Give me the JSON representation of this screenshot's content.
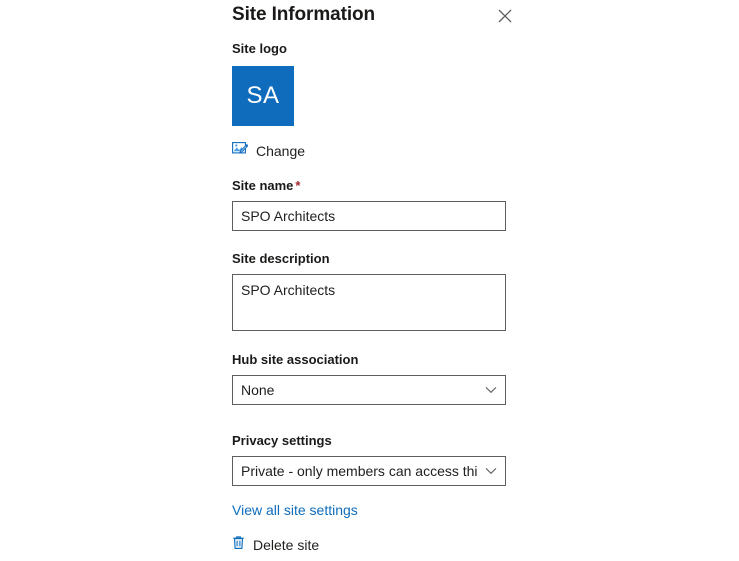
{
  "panel": {
    "title": "Site Information",
    "close_icon": "close-icon"
  },
  "logo": {
    "label": "Site logo",
    "initials": "SA",
    "background_color": "#0f6cbd",
    "change_label": "Change",
    "change_icon": "image-edit-icon"
  },
  "site_name": {
    "label": "Site name",
    "required_marker": "*",
    "value": "SPO Architects",
    "placeholder": ""
  },
  "site_description": {
    "label": "Site description",
    "value": "SPO Architects",
    "placeholder": ""
  },
  "hub_site": {
    "label": "Hub site association",
    "value": "None",
    "caret_icon": "chevron-down-icon"
  },
  "privacy": {
    "label": "Privacy settings",
    "value": "Private - only members can access this ...",
    "caret_icon": "chevron-down-icon"
  },
  "links": {
    "view_all_site_settings": "View all site settings",
    "delete_site": "Delete site",
    "delete_icon": "trash-icon"
  },
  "colors": {
    "accent": "#0f6cbd",
    "required": "#a4262c",
    "border": "#605e5c",
    "text": "#201f1e"
  }
}
